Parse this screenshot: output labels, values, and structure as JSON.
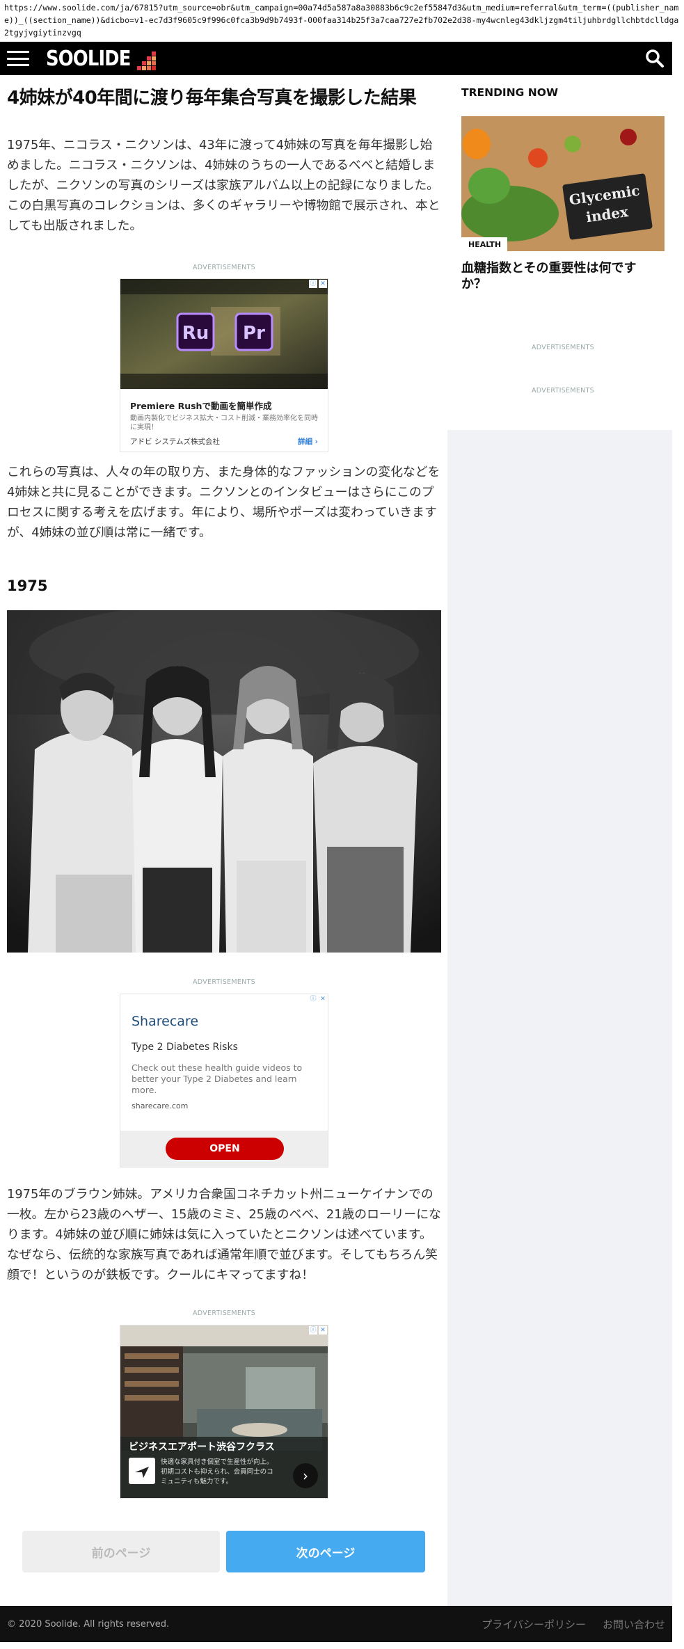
{
  "browser": {
    "url": "https://www.soolide.com/ja/67815?utm_source=obr&utm_campaign=00a74d5a587a8a30883b6c9c2ef55847d3&utm_medium=referral&utm_term=((publisher_name))_((section_name))&dicbo=v1-ec7d3f9605c9f996c0fca3b9d9b7493f-000faa314b25f3a7caa727e2fb702e2d38-my4wcnleg43dkljzgm4tiljuhbrdgllchbtdclldga2tgyjvgiytinzvgq"
  },
  "nav": {
    "logo": "SOOLIDE"
  },
  "article": {
    "title": "4姉妹が40年間に渡り毎年集合写真を撮影した結果",
    "intro": "1975年、ニコラス・ニクソンは、43年に渡って4姉妹の写真を毎年撮影し始めました。ニコラス・ニクソンは、4姉妹のうちの一人であるべべと結婚しましたが、ニクソンの写真のシリーズは家族アルバム以上の記録になりました。この白黒写真のコレクションは、多くのギャラリーや博物館で展示され、本としても出版されました。",
    "para2": "これらの写真は、人々の年の取り方、また身体的なファッションの変化などを4姉妹と共に見ることができます。ニクソンとのインタビューはさらにこのプロセスに関する考えを広げます。年により、場所やポーズは変わっていきますが、4姉妹の並び順は常に一緒です。",
    "year": "1975",
    "caption": "1975年のブラウン姉妹。アメリカ合衆国コネチカット州ニューケイナンでの一枚。左から23歳のヘザー、15歳のミミ、25歳のベベ、21歳のローリーになります。4姉妹の並び順に姉妹は気に入っていたとニクソンは述べています。なぜなら、伝統的な家族写真であれば通常年順で並びます。そしてもちろん笑顔で！というのが鉄板です。クールにキマってますね！"
  },
  "ads": {
    "label": "ADVERTISEMENTS",
    "adobe": {
      "title": "Premiere Rushで動画を簡単作成",
      "desc": "動画内製化でビジネス拡大・コスト削減・業務効率化を同時に実現！",
      "advertiser": "アドビ システムズ株式会社",
      "cta": "詳細",
      "icon1": "Ru",
      "icon2": "Pr"
    },
    "sharecare": {
      "brand": "Sharecare",
      "headline": "Type 2 Diabetes Risks",
      "body": "Check out these health guide videos to better your Type 2 Diabetes and learn more.",
      "domain": "sharecare.com",
      "cta": "OPEN"
    },
    "office": {
      "title": "ビジネスエアポート渋谷フクラス",
      "desc": "快適な家具付き個室で生産性が向上。初期コストも抑えられ、会員同士のコミュニティも魅力です。"
    }
  },
  "sidebar": {
    "trending_title": "TRENDING NOW",
    "trend_badge": "HEALTH",
    "trend_image_text_1": "Glycemic",
    "trend_image_text_2": "index",
    "trend_caption": "血糖指数とその重要性は何ですか？"
  },
  "pagination": {
    "prev": "前のページ",
    "next": "次のページ"
  },
  "footer": {
    "copyright": "© 2020 Soolide. All rights reserved.",
    "privacy": "プライバシーポリシー",
    "contact": "お問い合わせ"
  },
  "colors": {
    "nav_bg": "#000000",
    "next_button": "#45aaf0",
    "sidebar_bg": "#f0f2f5",
    "cta_red": "#cc0000"
  }
}
